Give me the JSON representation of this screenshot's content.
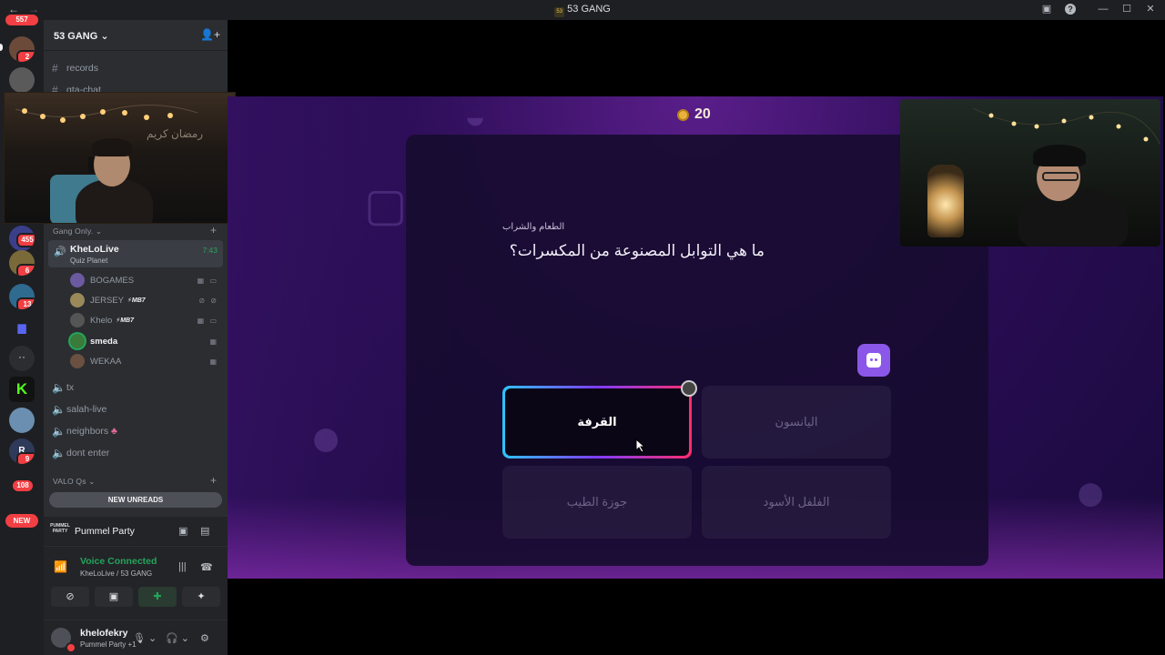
{
  "window": {
    "title": "53 GANG",
    "server_tag": "53"
  },
  "rail": {
    "servers": [
      {
        "name": "server-1",
        "color": "#6b4a3a",
        "badge": "2",
        "speaking": true
      },
      {
        "name": "server-2",
        "color": "#5a5a5a",
        "badge": "",
        "speaking": true
      },
      {
        "name": "server-3",
        "color": "#3b3f8a",
        "badge": "455",
        "speaking": false
      },
      {
        "name": "server-4",
        "color": "#7a6a3a",
        "badge": "6",
        "speaking": true
      },
      {
        "name": "server-5",
        "color": "#2f6a8f",
        "badge": "13",
        "speaking": false
      },
      {
        "name": "server-6",
        "color": "#5865f2",
        "badge": "",
        "speaking": false
      },
      {
        "name": "server-7",
        "color": "#2b2d31",
        "badge": "",
        "speaking": false
      },
      {
        "name": "server-kick",
        "color": "#53fc18",
        "badge": "",
        "speaking": false
      },
      {
        "name": "server-9",
        "color": "#6a8fb0",
        "badge": "",
        "speaking": false
      },
      {
        "name": "server-10",
        "color": "#2f3a5a",
        "badge": "9",
        "speaking": true
      }
    ],
    "top_badge": "557",
    "bottom_badge": "108",
    "new_label": "NEW"
  },
  "sidebar": {
    "guild_name": "53 GANG",
    "channels_top": [
      {
        "label": "records",
        "symbol": "#"
      },
      {
        "label": "gta-chat",
        "symbol": "#"
      }
    ],
    "category_gang": "Gang Only.",
    "active_voice": {
      "label": "KheLoLive",
      "activity": "Quiz Planet",
      "time": "7:43"
    },
    "members": [
      {
        "name": "BOGAMES",
        "tag": "",
        "color": "#6b5aa0"
      },
      {
        "name": "JERSEY",
        "tag": "⚡MB7",
        "color": "#9a8a5a"
      },
      {
        "name": "Khelo",
        "tag": "⚡MB7",
        "color": "#555"
      },
      {
        "name": "smeda",
        "tag": "",
        "color": "#3a7a3a"
      },
      {
        "name": "WEKAA",
        "tag": "",
        "color": "#6a5040"
      }
    ],
    "voice_channels": [
      {
        "label": "tx"
      },
      {
        "label": "salah-live"
      },
      {
        "label": "neighbors",
        "emoji": "♣"
      },
      {
        "label": "dont enter"
      }
    ],
    "category_valo": "VALO Qs",
    "new_unreads": "NEW UNREADS"
  },
  "activity": {
    "logo": "PUMMEL PARTY",
    "name": "Pummel Party"
  },
  "voice": {
    "status": "Voice Connected",
    "channel": "KheLoLive / 53 GANG"
  },
  "user": {
    "name": "khelofekry",
    "status": "Pummel Party +1"
  },
  "webcam_left": {
    "overlay_text": "رمضان كريم"
  },
  "game": {
    "coins": "20",
    "category": "الطعام والشراب",
    "question": "ما هي التوابل المصنوعة من المكسرات؟",
    "answers": [
      {
        "label": "القرفة",
        "selected": true
      },
      {
        "label": "اليانسون",
        "selected": false
      },
      {
        "label": "جوزة الطيب",
        "selected": false
      },
      {
        "label": "الفلفل الأسود",
        "selected": false
      }
    ]
  },
  "colors": {
    "accent_green": "#23a55a",
    "danger": "#f23f43",
    "purple": "#8b57e8"
  }
}
